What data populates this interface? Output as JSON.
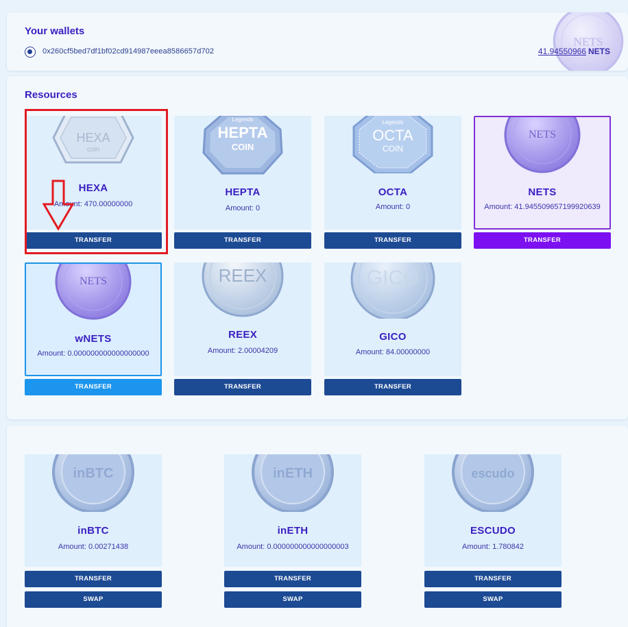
{
  "wallet": {
    "title": "Your wallets",
    "address": "0x260cf5bed7df1bf02cd914987eeea8586657d702",
    "balance": "41.94550966",
    "currency": "NETS",
    "coin_label": "NETS"
  },
  "resources": {
    "title": "Resources",
    "cards": [
      {
        "name": "HEXA",
        "amount": "Amount: 470.00000000",
        "coin_text": "HEXA",
        "coin_sub": "coin",
        "button": "TRANSFER"
      },
      {
        "name": "HEPTA",
        "amount": "Amount: 0",
        "coin_text": "HEPTA",
        "coin_sub": "COIN",
        "coin_top": "Legends",
        "button": "TRANSFER"
      },
      {
        "name": "OCTA",
        "amount": "Amount: 0",
        "coin_text": "OCTA",
        "coin_sub": "COIN",
        "coin_top": "Legends",
        "button": "TRANSFER"
      },
      {
        "name": "NETS",
        "amount": "Amount: 41.945509657199920639",
        "coin_text": "NETS",
        "button": "TRANSFER"
      },
      {
        "name": "wNETS",
        "amount": "Amount: 0.000000000000000000",
        "coin_text": "NETS",
        "button": "TRANSFER"
      },
      {
        "name": "REEX",
        "amount": "Amount: 2.00004209",
        "coin_text": "REEX",
        "button": "TRANSFER"
      },
      {
        "name": "GICO",
        "amount": "Amount: 84.00000000",
        "coin_text": "GICO",
        "button": "TRANSFER"
      }
    ]
  },
  "tokens": {
    "cards": [
      {
        "name": "inBTC",
        "amount": "Amount: 0.00271438",
        "coin_text": "inBTC",
        "transfer": "TRANSFER",
        "swap": "SWAP"
      },
      {
        "name": "inETH",
        "amount": "Amount: 0.000000000000000003",
        "coin_text": "inETH",
        "transfer": "TRANSFER",
        "swap": "SWAP"
      },
      {
        "name": "ESCUDO",
        "amount": "Amount: 1.780842",
        "coin_text": "escudo",
        "transfer": "TRANSFER",
        "swap": "SWAP"
      }
    ]
  },
  "colors": {
    "accent_text": "#3a1fc0",
    "button_blue": "#1c4a93",
    "button_purple": "#7c10f0",
    "button_light_blue": "#1b95ee",
    "annotation_red": "#e21b22"
  }
}
